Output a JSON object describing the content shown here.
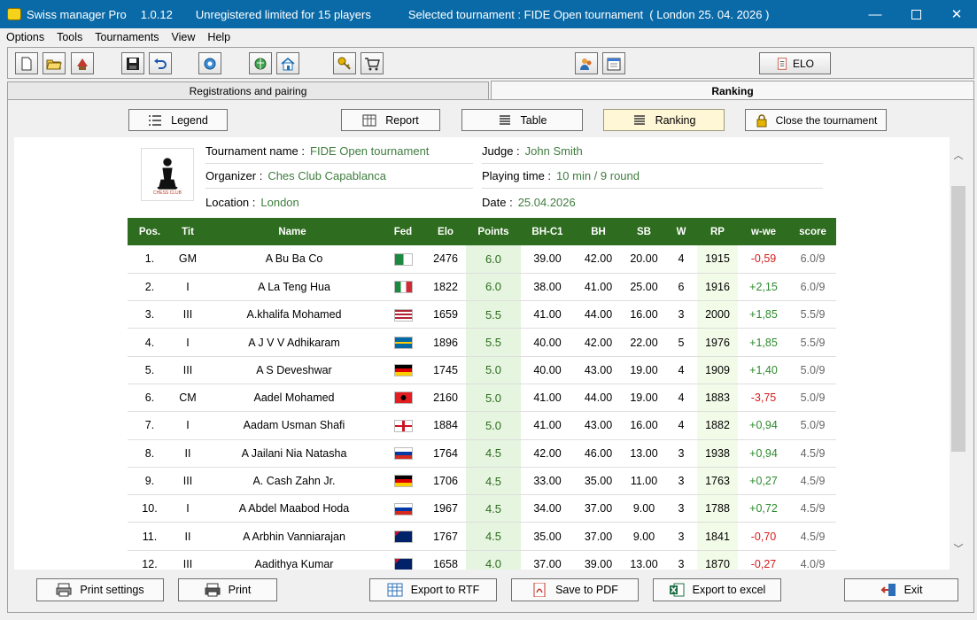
{
  "titlebar": {
    "app_name": "Swiss manager Pro",
    "version": "1.0.12",
    "license": "Unregistered limited for 15 players",
    "selected": "Selected tournament : FIDE Open tournament  ( London 25. 04. 2026 )"
  },
  "menu": [
    "Options",
    "Tools",
    "Tournaments",
    "View",
    "Help"
  ],
  "toolbar": {
    "elo_label": "ELO",
    "icons": [
      "new-file-icon",
      "open-folder-icon",
      "tournament-icon",
      "save-icon",
      "undo-icon",
      "settings-icon",
      "fide-globe-icon",
      "home-icon",
      "key-icon",
      "cart-icon",
      "players-icon",
      "calendar-icon",
      "document-icon"
    ]
  },
  "tabs": {
    "registrations": "Registrations and pairing",
    "ranking": "Ranking"
  },
  "actions": {
    "legend": "Legend",
    "report": "Report",
    "table": "Table",
    "ranking": "Ranking",
    "close": "Close the tournament"
  },
  "tournament": {
    "logo_text": "CHESS CLUB",
    "name_label": "Tournament name :",
    "name": "FIDE Open tournament",
    "organizer_label": "Organizer :",
    "organizer": "Ches Club Capablanca",
    "location_label": "Location :",
    "location": "London",
    "judge_label": "Judge :",
    "judge": "John Smith",
    "time_label": "Playing time :",
    "time": "10 min / 9 round",
    "date_label": "Date :",
    "date": "25.04.2026"
  },
  "columns": [
    "Pos.",
    "Tit",
    "Name",
    "Fed",
    "Elo",
    "Points",
    "BH-C1",
    "BH",
    "SB",
    "W",
    "RP",
    "w-we",
    "score"
  ],
  "rows": [
    {
      "pos": "1.",
      "tit": "GM",
      "name": "A Bu Ba Co",
      "fed": "ALG",
      "elo": "2476",
      "points": "6.0",
      "bhc1": "39.00",
      "bh": "42.00",
      "sb": "20.00",
      "w": "4",
      "rp": "1915",
      "wwe": "-0,59",
      "score": "6.0/9"
    },
    {
      "pos": "2.",
      "tit": "I",
      "name": "A La Teng Hua",
      "fed": "ITA",
      "elo": "1822",
      "points": "6.0",
      "bhc1": "38.00",
      "bh": "41.00",
      "sb": "25.00",
      "w": "6",
      "rp": "1916",
      "wwe": "+2,15",
      "score": "6.0/9"
    },
    {
      "pos": "3.",
      "tit": "III",
      "name": "A.khalifa Mohamed",
      "fed": "USA",
      "elo": "1659",
      "points": "5.5",
      "bhc1": "41.00",
      "bh": "44.00",
      "sb": "16.00",
      "w": "3",
      "rp": "2000",
      "wwe": "+1,85",
      "score": "5.5/9"
    },
    {
      "pos": "4.",
      "tit": "I",
      "name": "A J V V Adhikaram",
      "fed": "SWE",
      "elo": "1896",
      "points": "5.5",
      "bhc1": "40.00",
      "bh": "42.00",
      "sb": "22.00",
      "w": "5",
      "rp": "1976",
      "wwe": "+1,85",
      "score": "5.5/9"
    },
    {
      "pos": "5.",
      "tit": "III",
      "name": "A S Deveshwar",
      "fed": "GER",
      "elo": "1745",
      "points": "5.0",
      "bhc1": "40.00",
      "bh": "43.00",
      "sb": "19.00",
      "w": "4",
      "rp": "1909",
      "wwe": "+1,40",
      "score": "5.0/9"
    },
    {
      "pos": "6.",
      "tit": "CM",
      "name": "Aadel Mohamed",
      "fed": "ALB",
      "elo": "2160",
      "points": "5.0",
      "bhc1": "41.00",
      "bh": "44.00",
      "sb": "19.00",
      "w": "4",
      "rp": "1883",
      "wwe": "-3,75",
      "score": "5.0/9"
    },
    {
      "pos": "7.",
      "tit": "I",
      "name": "Aadam Usman Shafi",
      "fed": "ENG",
      "elo": "1884",
      "points": "5.0",
      "bhc1": "41.00",
      "bh": "43.00",
      "sb": "16.00",
      "w": "4",
      "rp": "1882",
      "wwe": "+0,94",
      "score": "5.0/9"
    },
    {
      "pos": "8.",
      "tit": "II",
      "name": "A Jailani Nia Natasha",
      "fed": "RUS",
      "elo": "1764",
      "points": "4.5",
      "bhc1": "42.00",
      "bh": "46.00",
      "sb": "13.00",
      "w": "3",
      "rp": "1938",
      "wwe": "+0,94",
      "score": "4.5/9"
    },
    {
      "pos": "9.",
      "tit": "III",
      "name": "A. Cash Zahn Jr.",
      "fed": "GER",
      "elo": "1706",
      "points": "4.5",
      "bhc1": "33.00",
      "bh": "35.00",
      "sb": "11.00",
      "w": "3",
      "rp": "1763",
      "wwe": "+0,27",
      "score": "4.5/9"
    },
    {
      "pos": "10.",
      "tit": "I",
      "name": "A Abdel Maabod Hoda",
      "fed": "RUS",
      "elo": "1967",
      "points": "4.5",
      "bhc1": "34.00",
      "bh": "37.00",
      "sb": "9.00",
      "w": "3",
      "rp": "1788",
      "wwe": "+0,72",
      "score": "4.5/9"
    },
    {
      "pos": "11.",
      "tit": "II",
      "name": "A Arbhin Vanniarajan",
      "fed": "AUS",
      "elo": "1767",
      "points": "4.5",
      "bhc1": "35.00",
      "bh": "37.00",
      "sb": "9.00",
      "w": "3",
      "rp": "1841",
      "wwe": "-0,70",
      "score": "4.5/9"
    },
    {
      "pos": "12.",
      "tit": "III",
      "name": "Aadithya Kumar",
      "fed": "AUS",
      "elo": "1658",
      "points": "4.0",
      "bhc1": "37.00",
      "bh": "39.00",
      "sb": "13.00",
      "w": "3",
      "rp": "1870",
      "wwe": "-0,27",
      "score": "4.0/9"
    }
  ],
  "bottom": {
    "print_settings": "Print settings",
    "print": "Print",
    "rtf": "Export to RTF",
    "pdf": "Save to PDF",
    "excel": "Export to excel",
    "exit": "Exit"
  },
  "colors": {
    "titlebar": "#0a6aa8",
    "table_header": "#2e6c1f",
    "info_value": "#3f7d3f",
    "negative": "#d61a1a",
    "positive": "#2f8a2f"
  }
}
